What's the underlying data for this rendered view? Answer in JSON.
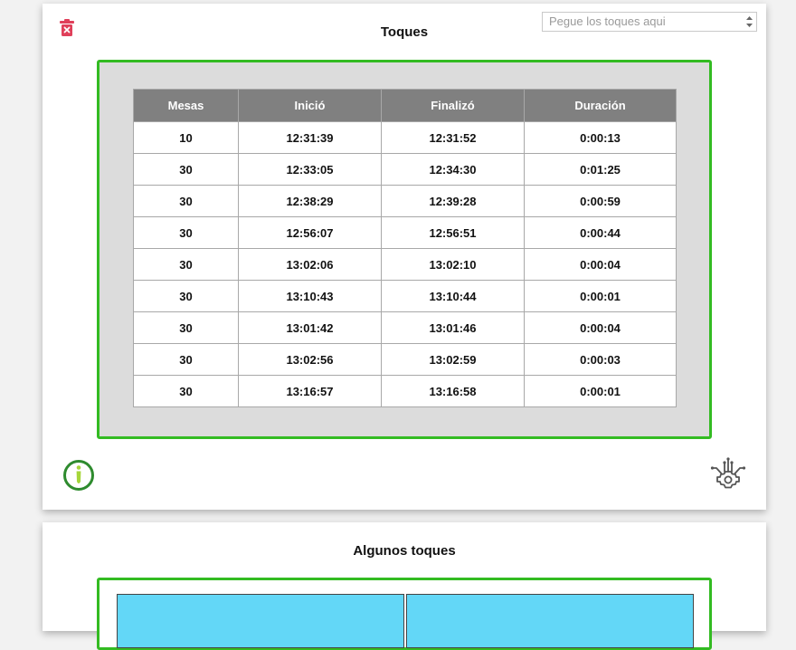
{
  "panel1": {
    "title": "Toques",
    "paste_placeholder": "Pegue los toques aqui",
    "table": {
      "headers": [
        "Mesas",
        "Inició",
        "Finalizó",
        "Duración"
      ],
      "rows": [
        [
          "10",
          "12:31:39",
          "12:31:52",
          "0:00:13"
        ],
        [
          "30",
          "12:33:05",
          "12:34:30",
          "0:01:25"
        ],
        [
          "30",
          "12:38:29",
          "12:39:28",
          "0:00:59"
        ],
        [
          "30",
          "12:56:07",
          "12:56:51",
          "0:00:44"
        ],
        [
          "30",
          "13:02:06",
          "13:02:10",
          "0:00:04"
        ],
        [
          "30",
          "13:10:43",
          "13:10:44",
          "0:00:01"
        ],
        [
          "30",
          "13:01:42",
          "13:01:46",
          "0:00:04"
        ],
        [
          "30",
          "13:02:56",
          "13:02:59",
          "0:00:03"
        ],
        [
          "30",
          "13:16:57",
          "13:16:58",
          "0:00:01"
        ]
      ]
    },
    "icons": {
      "delete": "trash-icon",
      "info": "info-icon",
      "settings": "circuit-gear-icon"
    }
  },
  "panel2": {
    "title": "Algunos toques"
  },
  "colors": {
    "frame_green": "#33bb22",
    "table_header": "#808080",
    "delete_red": "#e0405a",
    "info_ring": "#2e8b2e",
    "info_fill": "#a6d63a",
    "cell_blue": "#63d7f7"
  }
}
